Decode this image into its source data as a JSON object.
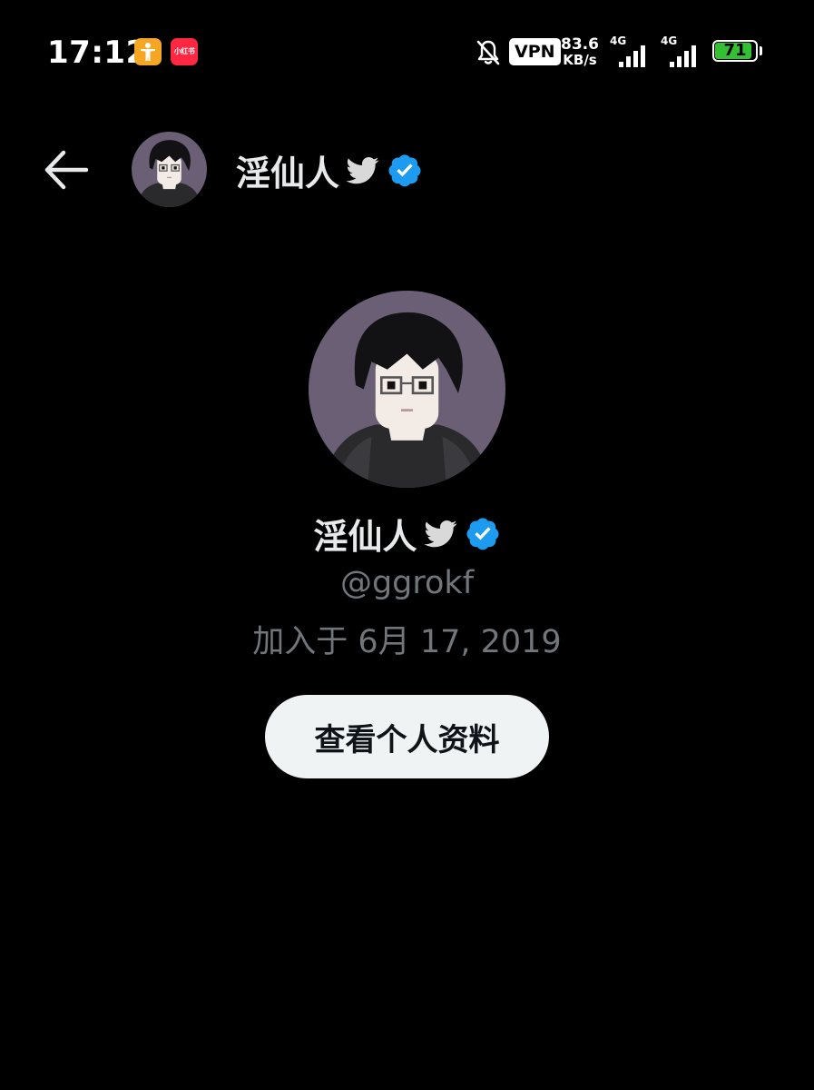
{
  "status_bar": {
    "time": "17:12",
    "xhs_label": "小红书",
    "vpn_label": "VPN",
    "net_speed_value": "83.6",
    "net_speed_unit": "KB/s",
    "signal_1_label": "4G",
    "signal_2_label": "4G",
    "battery_level": "71",
    "battery_color": "#33c033"
  },
  "header": {
    "display_name": "淫仙人",
    "verified": true,
    "bird_icon": "twitter-bird-icon",
    "verified_icon": "verified-badge-icon"
  },
  "profile": {
    "display_name": "淫仙人",
    "handle": "@ggrokf",
    "joined": "加入于 6月 17, 2019",
    "view_profile_label": "查看个人资料"
  },
  "colors": {
    "background": "#000000",
    "primary_text": "#e7e9ea",
    "secondary_text": "#71767b",
    "verified_blue": "#1d9bf0",
    "avatar_bg": "#6b5f76",
    "button_bg": "#eff3f4"
  }
}
